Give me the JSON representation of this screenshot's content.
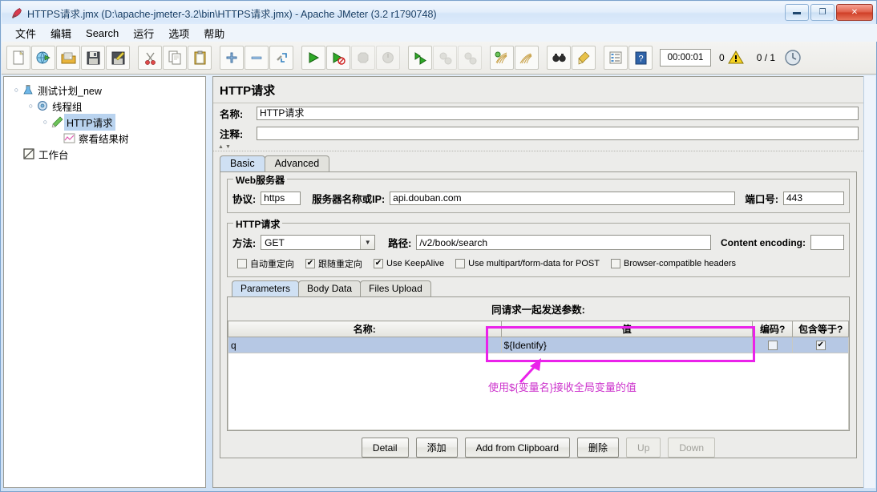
{
  "window": {
    "title": "HTTPS请求.jmx (D:\\apache-jmeter-3.2\\bin\\HTTPS请求.jmx) - Apache JMeter (3.2 r1790748)",
    "app_icon": "jmeter-feather-icon",
    "controls": {
      "minimize": "minimize-icon",
      "maximize": "maximize-icon",
      "close": "close-icon"
    }
  },
  "menu": {
    "items": [
      {
        "label": "文件",
        "name": "menu-file"
      },
      {
        "label": "编辑",
        "name": "menu-edit"
      },
      {
        "label": "Search",
        "name": "menu-search"
      },
      {
        "label": "运行",
        "name": "menu-run"
      },
      {
        "label": "选项",
        "name": "menu-options"
      },
      {
        "label": "帮助",
        "name": "menu-help"
      }
    ]
  },
  "toolbar": {
    "buttons": [
      {
        "name": "new-icon",
        "glyph": "page"
      },
      {
        "name": "templates-icon",
        "glyph": "templates"
      },
      {
        "name": "open-icon",
        "glyph": "folder"
      },
      {
        "name": "save-icon",
        "glyph": "floppy"
      },
      {
        "name": "save-as-icon",
        "glyph": "saveas"
      },
      {
        "name": "cut-icon",
        "glyph": "scissors"
      },
      {
        "name": "copy-icon",
        "glyph": "copy"
      },
      {
        "name": "paste-icon",
        "glyph": "clipboard"
      },
      {
        "name": "expand-icon",
        "glyph": "plus"
      },
      {
        "name": "collapse-icon",
        "glyph": "minus"
      },
      {
        "name": "toggle-icon",
        "glyph": "toggle"
      },
      {
        "name": "start-icon",
        "glyph": "play"
      },
      {
        "name": "start-no-pauses-icon",
        "glyph": "play-no-pause"
      },
      {
        "name": "stop-icon",
        "glyph": "stop",
        "disabled": true
      },
      {
        "name": "shutdown-icon",
        "glyph": "shutdown",
        "disabled": true
      },
      {
        "name": "start-remote-icon",
        "glyph": "play-remote"
      },
      {
        "name": "stop-remote-icon",
        "glyph": "stop-remote",
        "disabled": true
      },
      {
        "name": "shutdown-remote-icon",
        "glyph": "shutdown-remote",
        "disabled": true
      },
      {
        "name": "clear-icon",
        "glyph": "clear"
      },
      {
        "name": "clear-all-icon",
        "glyph": "clear-all"
      },
      {
        "name": "search-icon",
        "glyph": "binoculars"
      },
      {
        "name": "reset-search-icon",
        "glyph": "broom"
      },
      {
        "name": "function-helper-icon",
        "glyph": "list"
      },
      {
        "name": "help-icon",
        "glyph": "help"
      }
    ],
    "elapsed_time": "00:00:01",
    "warning_count": "0",
    "warning_icon": "warning-triangle-icon",
    "thread_count": "0 / 1",
    "clock_icon": "clock-icon"
  },
  "tree": {
    "nodes": [
      {
        "label": "测试计划_new",
        "icon": "test-plan-icon",
        "depth": 0,
        "selected": false,
        "expander": "expanded"
      },
      {
        "label": "线程组",
        "icon": "thread-group-icon",
        "depth": 1,
        "selected": false,
        "expander": "expanded"
      },
      {
        "label": "HTTP请求",
        "icon": "http-sampler-icon",
        "depth": 2,
        "selected": true,
        "expander": "expanded"
      },
      {
        "label": "察看结果树",
        "icon": "view-results-tree-icon",
        "depth": 3,
        "selected": false,
        "expander": "none"
      },
      {
        "label": "工作台",
        "icon": "workbench-icon",
        "depth": 0,
        "selected": false,
        "expander": "none"
      }
    ]
  },
  "panel": {
    "title": "HTTP请求",
    "name_label": "名称:",
    "name_value": "HTTP请求",
    "comment_label": "注释:",
    "comment_value": "",
    "tabs": [
      {
        "label": "Basic",
        "name": "tab-basic",
        "active": true
      },
      {
        "label": "Advanced",
        "name": "tab-advanced",
        "active": false
      }
    ],
    "web_server": {
      "group_title": "Web服务器",
      "protocol_label": "协议:",
      "protocol_value": "https",
      "server_label": "服务器名称或IP:",
      "server_value": "api.douban.com",
      "port_label": "端口号:",
      "port_value": "443"
    },
    "http_request": {
      "group_title": "HTTP请求",
      "method_label": "方法:",
      "method_value": "GET",
      "path_label": "路径:",
      "path_value": "/v2/book/search",
      "content_encoding_label": "Content encoding:",
      "content_encoding_value": "",
      "checkboxes": [
        {
          "label": "自动重定向",
          "checked": false,
          "name": "checkbox-auto-redirect"
        },
        {
          "label": "跟随重定向",
          "checked": true,
          "name": "checkbox-follow-redirects"
        },
        {
          "label": "Use KeepAlive",
          "checked": true,
          "name": "checkbox-keepalive"
        },
        {
          "label": "Use multipart/form-data for POST",
          "checked": false,
          "name": "checkbox-multipart"
        },
        {
          "label": "Browser-compatible headers",
          "checked": false,
          "name": "checkbox-browser-compatible"
        }
      ]
    },
    "param_tabs": [
      {
        "label": "Parameters",
        "name": "tab-parameters",
        "active": true
      },
      {
        "label": "Body Data",
        "name": "tab-body-data",
        "active": false
      },
      {
        "label": "Files Upload",
        "name": "tab-files-upload",
        "active": false
      }
    ],
    "param_table": {
      "caption": "同请求一起发送参数:",
      "columns": [
        "名称:",
        "值",
        "编码?",
        "包含等于?"
      ],
      "rows": [
        {
          "name": "q",
          "value": "${Identify}",
          "encode": false,
          "include_equals": true
        }
      ]
    },
    "buttons": [
      {
        "label": "Detail",
        "name": "detail-button",
        "disabled": false
      },
      {
        "label": "添加",
        "name": "add-button",
        "disabled": false
      },
      {
        "label": "Add from Clipboard",
        "name": "add-from-clipboard-button",
        "disabled": false
      },
      {
        "label": "删除",
        "name": "delete-button",
        "disabled": false
      },
      {
        "label": "Up",
        "name": "up-button",
        "disabled": true
      },
      {
        "label": "Down",
        "name": "down-button",
        "disabled": true
      }
    ]
  },
  "annotation": {
    "text": "使用${变量名}接收全局变量的值",
    "color": "#ea22ea"
  }
}
